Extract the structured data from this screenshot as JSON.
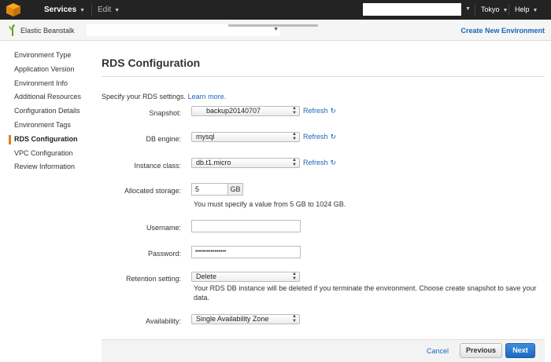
{
  "topnav": {
    "services_label": "Services",
    "edit_label": "Edit",
    "region_label": "Tokyo",
    "help_label": "Help"
  },
  "subbar": {
    "service_title": "Elastic Beanstalk",
    "create_env_label": "Create New Environment"
  },
  "sidebar": {
    "items": [
      {
        "label": "Environment Type"
      },
      {
        "label": "Application Version"
      },
      {
        "label": "Environment Info"
      },
      {
        "label": "Additional Resources"
      },
      {
        "label": "Configuration Details"
      },
      {
        "label": "Environment Tags"
      },
      {
        "label": "RDS Configuration"
      },
      {
        "label": "VPC Configuration"
      },
      {
        "label": "Review Information"
      }
    ],
    "active_index": 6
  },
  "main": {
    "title": "RDS Configuration",
    "intro_text": "Specify your RDS settings.",
    "learn_more": "Learn more.",
    "refresh_label": "Refresh",
    "fields": {
      "snapshot": {
        "label": "Snapshot:",
        "value": "backup20140707"
      },
      "db_engine": {
        "label": "DB engine:",
        "value": "mysql"
      },
      "instance_class": {
        "label": "Instance class:",
        "value": "db.t1.micro"
      },
      "storage": {
        "label": "Allocated storage:",
        "value": "5",
        "unit": "GB",
        "help": "You must specify a value from 5 GB to 1024 GB."
      },
      "username": {
        "label": "Username:",
        "value": ""
      },
      "password": {
        "label": "Password:",
        "value": "••••••••••••••••"
      },
      "retention": {
        "label": "Retention setting:",
        "value": "Delete",
        "help": "Your RDS DB instance will be deleted if you terminate the environment. Choose create snapshot to save your data."
      },
      "availability": {
        "label": "Availability:",
        "value": "Single Availability Zone"
      }
    }
  },
  "footer": {
    "cancel_label": "Cancel",
    "previous_label": "Previous",
    "next_label": "Next"
  },
  "colors": {
    "nav_bg": "#232323",
    "link": "#1a66b8",
    "accent": "#e77c1b",
    "primary_button": "#1e68bf"
  }
}
